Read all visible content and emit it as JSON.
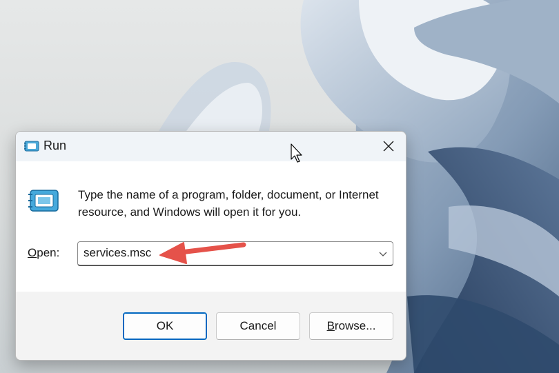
{
  "dialog": {
    "title": "Run",
    "description": "Type the name of a program, folder, document, or Internet resource, and Windows will open it for you.",
    "open_label_prefix": "O",
    "open_label_rest": "pen:",
    "open_value": "services.msc",
    "buttons": {
      "ok": "OK",
      "cancel": "Cancel",
      "browse_prefix": "B",
      "browse_rest": "rowse..."
    }
  },
  "icons": {
    "title": "run-icon",
    "close": "close-icon",
    "dropdown": "chevron-down-icon",
    "annotation": "red-arrow-icon",
    "cursor": "mouse-cursor-icon"
  },
  "colors": {
    "accent": "#0067c0",
    "annotation_arrow": "#e5524a"
  }
}
